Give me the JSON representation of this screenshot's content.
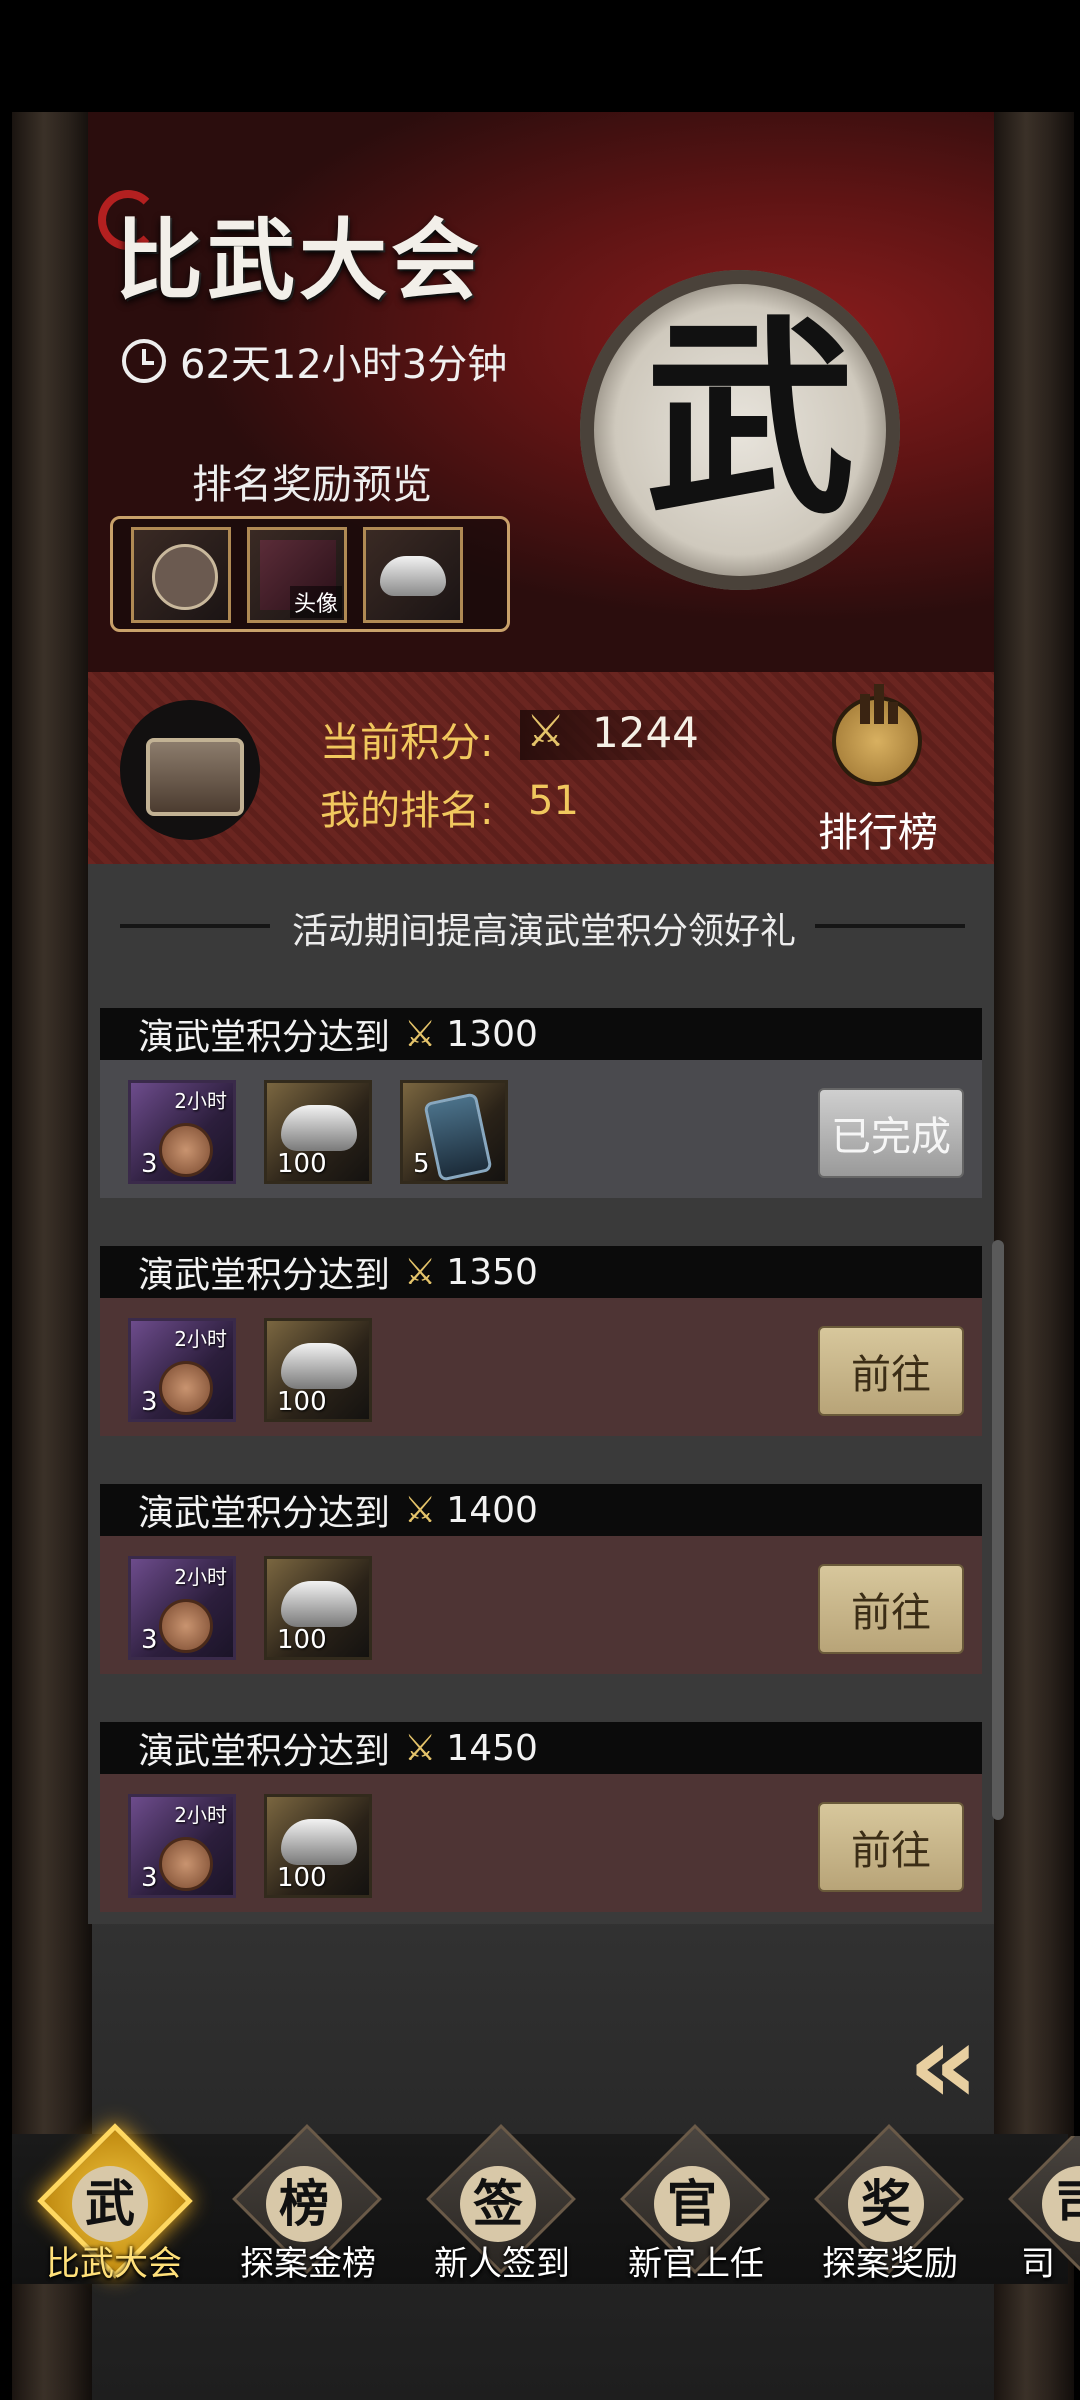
{
  "header": {
    "title": "比武大会",
    "timer": "62天12小时3分钟",
    "preview_title": "排名奖励预览",
    "preview_items": [
      {
        "icon": "character-portrait-icon",
        "tag": ""
      },
      {
        "icon": "avatar-frame-icon",
        "tag": "头像"
      },
      {
        "icon": "silver-ingot-icon",
        "tag": ""
      }
    ],
    "emblem_char": "武"
  },
  "score": {
    "points_label": "当前积分:",
    "points_value": "1244",
    "rank_label": "我的排名:",
    "rank_value": "51",
    "leaderboard_label": "排行榜"
  },
  "banner": "活动期间提高演武堂积分领好礼",
  "tasks": [
    {
      "label": "演武堂积分达到",
      "target": "1300",
      "button": "已完成",
      "state": "done",
      "rewards": [
        {
          "icon": "copper-coin-icon",
          "qty": "3",
          "time": "2小时"
        },
        {
          "icon": "silver-ingot-icon",
          "qty": "100",
          "time": ""
        },
        {
          "icon": "token-icon",
          "qty": "5",
          "time": ""
        }
      ]
    },
    {
      "label": "演武堂积分达到",
      "target": "1350",
      "button": "前往",
      "state": "go",
      "rewards": [
        {
          "icon": "copper-coin-icon",
          "qty": "3",
          "time": "2小时"
        },
        {
          "icon": "silver-ingot-icon",
          "qty": "100",
          "time": ""
        }
      ]
    },
    {
      "label": "演武堂积分达到",
      "target": "1400",
      "button": "前往",
      "state": "go",
      "rewards": [
        {
          "icon": "copper-coin-icon",
          "qty": "3",
          "time": "2小时"
        },
        {
          "icon": "silver-ingot-icon",
          "qty": "100",
          "time": ""
        }
      ]
    },
    {
      "label": "演武堂积分达到",
      "target": "1450",
      "button": "前往",
      "state": "go",
      "rewards": [
        {
          "icon": "copper-coin-icon",
          "qty": "3",
          "time": "2小时"
        },
        {
          "icon": "silver-ingot-icon",
          "qty": "100",
          "time": ""
        }
      ]
    }
  ],
  "nav": [
    {
      "label": "比武大会",
      "glyph": "武",
      "active": true
    },
    {
      "label": "探案金榜",
      "glyph": "榜",
      "active": false
    },
    {
      "label": "新人签到",
      "glyph": "签",
      "active": false
    },
    {
      "label": "新官上任",
      "glyph": "官",
      "active": false
    },
    {
      "label": "探案奖励",
      "glyph": "奖",
      "active": false
    },
    {
      "label": "司",
      "glyph": "司",
      "active": false
    }
  ],
  "colors": {
    "accent_gold": "#f1c85e",
    "header_red": "#5e1414",
    "go_button": "#c9b78a",
    "done_button": "#b5b5b5"
  }
}
